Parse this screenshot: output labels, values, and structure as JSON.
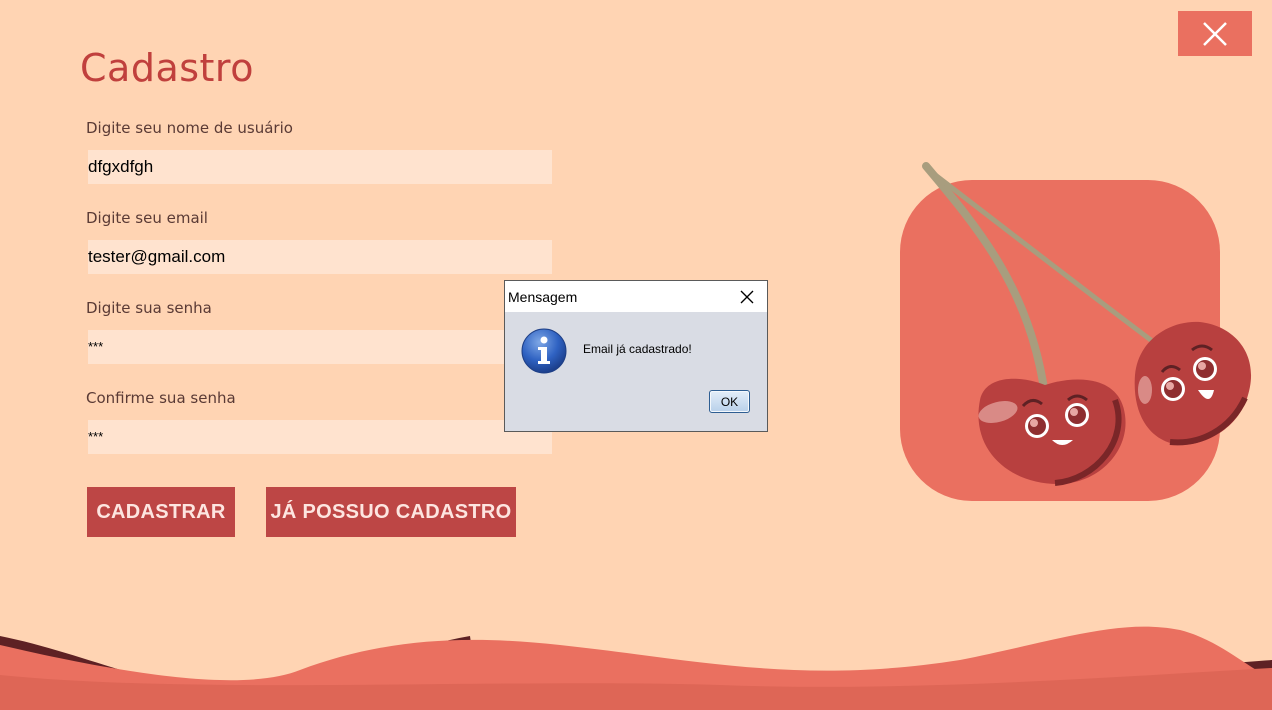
{
  "window": {
    "close_icon": "close-icon",
    "accent_color": "#EA7060"
  },
  "form": {
    "title": "Cadastro",
    "fields": [
      {
        "label": "Digite seu nome de usuário",
        "value": "dfgxdfgh"
      },
      {
        "label": "Digite seu email",
        "value": "tester@gmail.com"
      },
      {
        "label": "Digite sua senha",
        "value": "***"
      },
      {
        "label": "Confirme sua senha",
        "value": "***"
      }
    ],
    "buttons": {
      "register": "CADASTRAR",
      "already_registered": "JÁ POSSUO CADASTRO"
    }
  },
  "dialog": {
    "title": "Mensagem",
    "message": "Email já cadastrado!",
    "ok_label": "OK",
    "icon": "info-icon"
  },
  "theme": {
    "background": "#FFD4B3",
    "title_color": "#C0403D",
    "button_color": "#BD4645",
    "input_color": "#FFE3CF"
  }
}
